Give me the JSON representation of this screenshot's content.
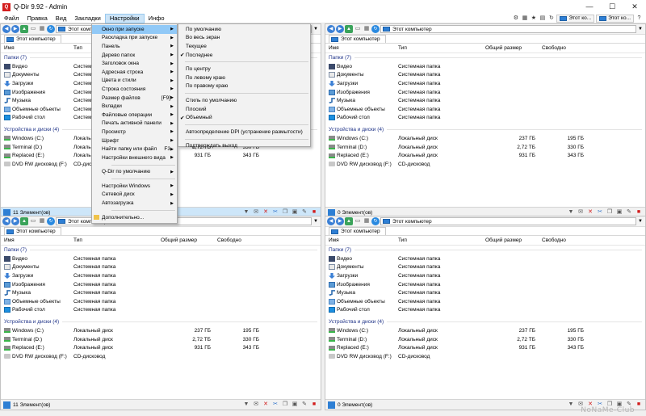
{
  "window": {
    "title": "Q-Dir 9.92 - Admin",
    "minimize": "—",
    "maximize": "☐",
    "close": "✕"
  },
  "menubar": {
    "items": [
      "Файл",
      "Правка",
      "Вид",
      "Закладки",
      "Настройки",
      "Инфо"
    ],
    "right_tabs": [
      "Этот ко...",
      "Этот ко..."
    ]
  },
  "address": {
    "path": "Этот компьютер"
  },
  "tab": {
    "label": "Этот компьютер"
  },
  "columns": {
    "name": "Имя",
    "type": "Тип",
    "total": "Общий размер",
    "free": "Свободно"
  },
  "groups": {
    "folders": "Папки (7)",
    "drives": "Устройства и диски (4)"
  },
  "folders": [
    {
      "name": "Видео",
      "type": "Системная папка",
      "icon": "video-folder-icon"
    },
    {
      "name": "Документы",
      "type": "Системная папка",
      "icon": "documents-folder-icon"
    },
    {
      "name": "Загрузки",
      "type": "Системная папка",
      "icon": "downloads-folder-icon"
    },
    {
      "name": "Изображения",
      "type": "Системная папка",
      "icon": "pictures-folder-icon"
    },
    {
      "name": "Музыка",
      "type": "Системная папка",
      "icon": "music-folder-icon"
    },
    {
      "name": "Объемные объекты",
      "type": "Системная папка",
      "icon": "3d-objects-folder-icon"
    },
    {
      "name": "Рабочий стол",
      "type": "Системная папка",
      "icon": "desktop-folder-icon"
    }
  ],
  "drives": [
    {
      "name": "Windows (C:)",
      "type": "Локальный диск",
      "total": "237 ГБ",
      "free": "195 ГБ"
    },
    {
      "name": "Terminal (D:)",
      "type": "Локальный диск",
      "total": "2,72 ТБ",
      "free": "330 ГБ"
    },
    {
      "name": "Replaced (E:)",
      "type": "Локальный диск",
      "total": "931 ГБ",
      "free": "343 ГБ"
    },
    {
      "name": "DVD RW дисковод (F:)",
      "type": "CD-дисковод",
      "total": "",
      "free": ""
    }
  ],
  "status": {
    "tl": "11 Элемент(ов)",
    "tr": "0 Элемент(ов)",
    "bl": "11 Элемент(ов)",
    "br": "0 Элемент(ов)"
  },
  "settings_menu": {
    "items": [
      {
        "label": "Окно при запуске",
        "arrow": "▶"
      },
      {
        "label": "Раскладка при запуске",
        "arrow": "▶"
      },
      {
        "label": "Панель",
        "arrow": "▶"
      },
      {
        "label": "Дерево папок",
        "arrow": "▶"
      },
      {
        "label": "Заголовок окна",
        "arrow": "▶"
      },
      {
        "label": "Адресная строка",
        "arrow": "▶"
      },
      {
        "label": "Цвета и стили",
        "arrow": "▶"
      },
      {
        "label": "Строка состояния",
        "arrow": "▶"
      },
      {
        "label": "Размер файлов",
        "shortcut": "[F9]",
        "arrow": "▶"
      },
      {
        "label": "Вкладки",
        "arrow": "▶"
      },
      {
        "label": "Файловые операции",
        "arrow": "▶"
      },
      {
        "label": "Печать активной панели",
        "arrow": "▶"
      },
      {
        "label": "Просмотр",
        "arrow": "▶"
      },
      {
        "label": "Шрифт",
        "arrow": "▶"
      },
      {
        "label": "Найти папку или файл",
        "shortcut": "F3",
        "arrow": "▶"
      },
      {
        "label": "Настройки внешнего вида",
        "arrow": "▶"
      }
    ],
    "items2": [
      {
        "label": "Q-Dir  по умолчанию",
        "arrow": "▶"
      }
    ],
    "items3": [
      {
        "label": "Настройки Windows",
        "arrow": "▶"
      },
      {
        "label": "Сетевой диск",
        "arrow": "▶"
      },
      {
        "label": "Автозагрузка",
        "arrow": "▶"
      }
    ],
    "more": "Дополнительно..."
  },
  "startup_submenu": {
    "group1": [
      "По умолчанию",
      "Во весь экран",
      "Текущее",
      "Последнее"
    ],
    "group2": [
      "По центру",
      "По левому  краю",
      "По правому  краю"
    ],
    "group3": [
      "Стиль по умолчанию",
      "Плоский",
      "Объемный"
    ],
    "dpi": "Автоопределение DPI (устранение размытости)",
    "confirm_exit": "Подтверждать выход",
    "checkmark": "✔"
  },
  "watermark": "NoNaMe-Club"
}
